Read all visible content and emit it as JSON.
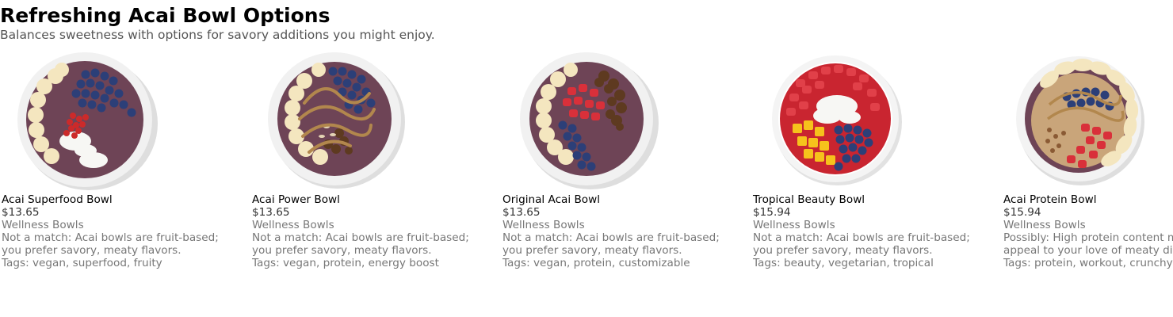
{
  "header": {
    "title": "Refreshing Acai Bowl Options",
    "subtitle": "Balances sweetness with options for savory additions you might enjoy."
  },
  "products": [
    {
      "name": "Acai Superfood Bowl",
      "price": "$13.65",
      "category": "Wellness Bowls",
      "note_line1": "Not a match: Acai bowls are fruit-based;",
      "note_line2": "you prefer savory, meaty flavors.",
      "tags": "Tags: vegan, superfood, fruity",
      "image_icon": "acai-bowl-image"
    },
    {
      "name": "Acai Power Bowl",
      "price": "$13.65",
      "category": "Wellness Bowls",
      "note_line1": "Not a match: Acai bowls are fruit-based;",
      "note_line2": "you prefer savory, meaty flavors.",
      "tags": "Tags: vegan, protein, energy boost",
      "image_icon": "acai-bowl-image"
    },
    {
      "name": "Original Acai Bowl",
      "price": "$13.65",
      "category": "Wellness Bowls",
      "note_line1": "Not a match: Acai bowls are fruit-based;",
      "note_line2": "you prefer savory, meaty flavors.",
      "tags": "Tags: vegan, protein, customizable",
      "image_icon": "acai-bowl-image"
    },
    {
      "name": "Tropical Beauty Bowl",
      "price": "$15.94",
      "category": "Wellness Bowls",
      "note_line1": "Not a match: Acai bowls are fruit-based;",
      "note_line2": "you prefer savory, meaty flavors.",
      "tags": "Tags: beauty, vegetarian, tropical",
      "image_icon": "acai-bowl-image"
    },
    {
      "name": "Acai Protein Bowl",
      "price": "$15.94",
      "category": "Wellness Bowls",
      "note_line1": "Possibly: High protein content might",
      "note_line2": "appeal to your love of meaty dishes.",
      "tags": "Tags: protein, workout, crunchy",
      "image_icon": "acai-bowl-image"
    }
  ],
  "colors": {
    "acai": "#6e4456",
    "bowl": "#f1f1f1",
    "banana": "#f4e6bf",
    "blueberry": "#2c3f78",
    "strawberry": "#d9303a",
    "goji": "#cc2a2a",
    "coconut": "#f7f7f4",
    "granola": "#5e3a20",
    "peanut_butter": "#b2874d",
    "mango": "#f6c21c",
    "almond": "#e4d4b4"
  }
}
